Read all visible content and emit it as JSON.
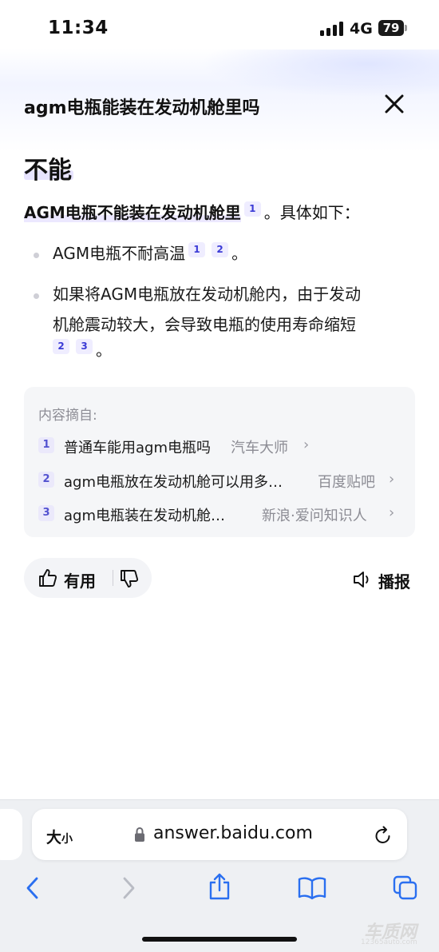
{
  "status_bar": {
    "time": "11:34",
    "network": "4G",
    "battery": "79"
  },
  "header": {
    "question": "agm电瓶能装在发动机舱里吗"
  },
  "answer": {
    "title": "不能",
    "intro_strong": "AGM电瓶不能装在发动机舱里",
    "intro_ref": "1",
    "intro_rest": "。具体如下：",
    "bullets": [
      {
        "line1": "AGM电瓶不耐高温",
        "refs": [
          "1",
          "2"
        ],
        "end": "。"
      },
      {
        "line1": "如果将AGM电瓶放在发动机舱内，由于发动",
        "line2": "机舱震动较大，会导致电瓶的使用寿命缩短",
        "refs": [
          "2",
          "3"
        ],
        "end": "。"
      }
    ]
  },
  "sources": {
    "heading": "内容摘自:",
    "items": [
      {
        "num": "1",
        "title": "普通车能用agm电瓶吗",
        "site": "汽车大师"
      },
      {
        "num": "2",
        "title": "agm电瓶放在发动机舱可以用多…",
        "site": "百度贴吧"
      },
      {
        "num": "3",
        "title": "agm电瓶装在发动机舱…",
        "site": "新浪·爱问知识人"
      }
    ]
  },
  "feedback": {
    "like_label": "有用",
    "broadcast_label": "播报"
  },
  "browser": {
    "text_size_big": "大",
    "text_size_small": "小",
    "url": "answer.baidu.com"
  },
  "watermark": {
    "logo": "车质网",
    "domain": "12365auto.com"
  },
  "colors": {
    "accent": "#3b3bd6",
    "ref_bg": "#efedff",
    "source_box": "#f5f6f8"
  },
  "icons": [
    "signal-icon",
    "battery-icon",
    "close-icon",
    "thumbs-up-icon",
    "thumbs-down-icon",
    "speaker-icon",
    "lock-icon",
    "reload-icon",
    "back-icon",
    "forward-icon",
    "share-icon",
    "bookmarks-icon",
    "tabs-icon"
  ]
}
